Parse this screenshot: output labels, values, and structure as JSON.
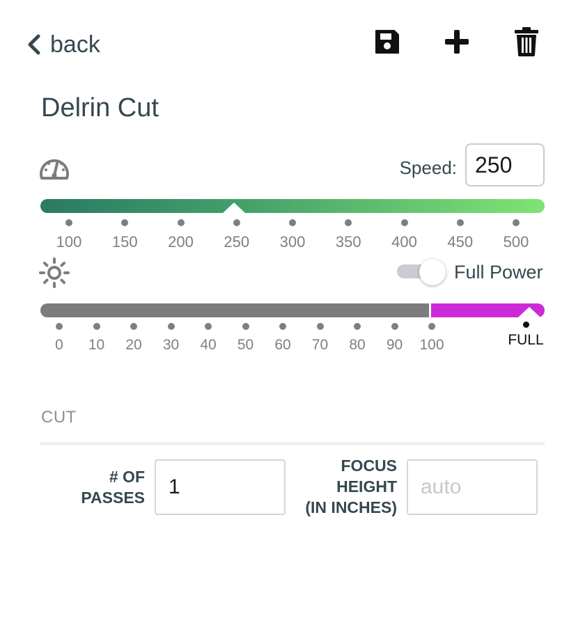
{
  "header": {
    "back_label": "back",
    "icons": [
      "save-icon",
      "plus-icon",
      "trash-icon"
    ]
  },
  "title": "Delrin Cut",
  "speed": {
    "label": "Speed:",
    "value": "250",
    "ticks": [
      "100",
      "150",
      "200",
      "250",
      "300",
      "350",
      "400",
      "450",
      "500"
    ],
    "slider_value": 250,
    "gradient": [
      "#2a7a64",
      "#7fe474"
    ]
  },
  "power": {
    "toggle_label": "Full Power",
    "toggle_on": true,
    "ticks": [
      "0",
      "10",
      "20",
      "30",
      "40",
      "50",
      "60",
      "70",
      "80",
      "90",
      "100"
    ],
    "full_label": "FULL",
    "slider_value": "FULL",
    "colors": {
      "track": "#7c7c7c",
      "full": "#cc2ad8"
    }
  },
  "cut": {
    "section_title": "CUT",
    "passes_label": "# OF\nPASSES",
    "passes_value": "1",
    "focus_label": "FOCUS\nHEIGHT\n(IN INCHES)",
    "focus_placeholder": "auto"
  }
}
